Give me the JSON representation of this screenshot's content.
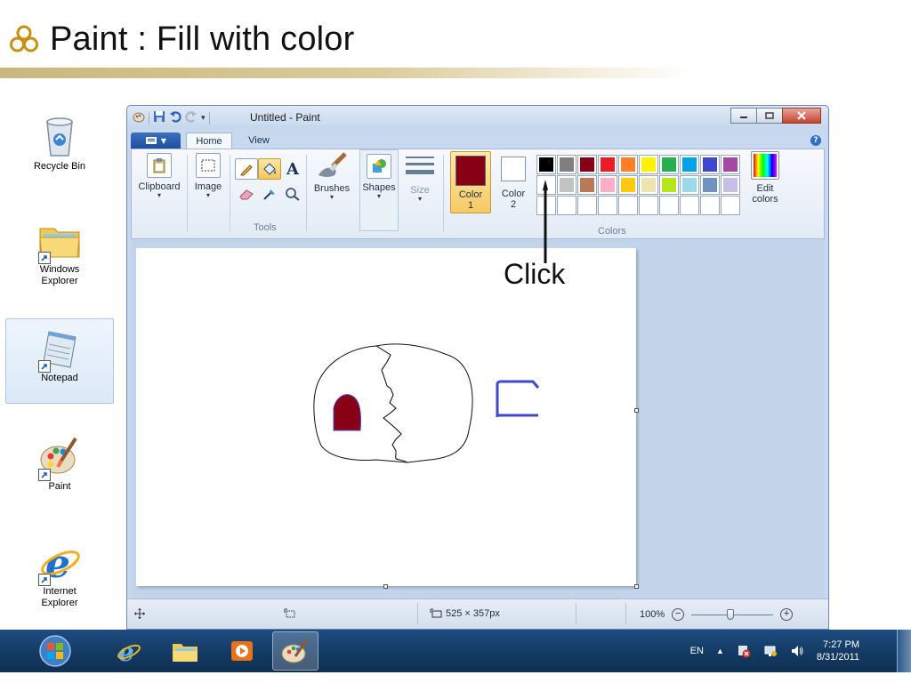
{
  "slide": {
    "title": "Paint : Fill with color"
  },
  "desktop": {
    "icons": [
      {
        "label": "Recycle Bin"
      },
      {
        "label": "Windows\nExplorer"
      },
      {
        "label": "Notepad"
      },
      {
        "label": "Paint"
      },
      {
        "label": "Internet\nExplorer"
      }
    ]
  },
  "window": {
    "title": "Untitled - Paint",
    "tabs": [
      "Home",
      "View"
    ],
    "ribbon": {
      "clipboard_label": "Clipboard",
      "image_label": "Image",
      "tools_group_label": "Tools",
      "brushes_label": "Brushes",
      "shapes_label": "Shapes",
      "size_label": "Size",
      "color1_label": "Color\n1",
      "color2_label": "Color\n2",
      "colors_group_label": "Colors",
      "edit_colors_label": "Edit\ncolors"
    },
    "colors": {
      "color1": "#880015",
      "color2": "#ffffff",
      "palette_row1": [
        "#000000",
        "#7f7f7f",
        "#880015",
        "#ed1c24",
        "#ff7f27",
        "#fff200",
        "#22b14c",
        "#00a2e8",
        "#3f48cc",
        "#a349a4"
      ],
      "palette_row2": [
        "#ffffff",
        "#c3c3c3",
        "#b97a57",
        "#ffaec9",
        "#ffc90e",
        "#efe4b0",
        "#b5e61d",
        "#99d9ea",
        "#7092be",
        "#c8bfe7"
      ]
    },
    "status": {
      "canvas_size": "525 × 357px",
      "zoom": "100%"
    }
  },
  "annotation": {
    "text": "Click"
  },
  "taskbar": {
    "lang": "EN",
    "time": "7:27 PM",
    "date": "8/31/2011"
  }
}
